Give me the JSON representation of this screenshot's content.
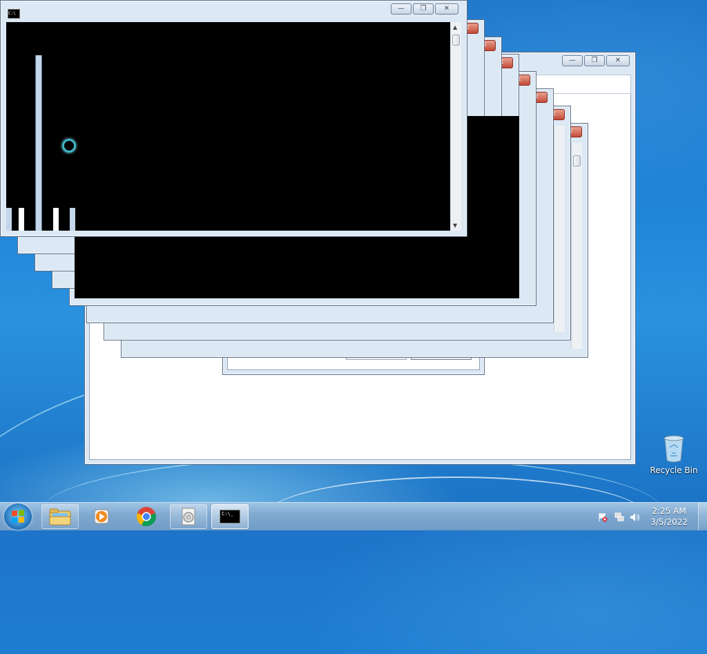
{
  "desktop": {
    "icons": [
      {
        "label": "Recycle Bin",
        "icon": "recycle-bin-icon"
      }
    ]
  },
  "windows": {
    "main": {
      "title_icon_text": "C:\\",
      "icon": "command-prompt-icon",
      "buttons": [
        "minimize",
        "maximize",
        "close"
      ]
    },
    "caption_glyphs": {
      "minimize": "—",
      "maximize": "❐",
      "close": "✕"
    }
  },
  "taskbar": {
    "start_icon": "windows-start-orb",
    "items": [
      {
        "name": "windows-explorer",
        "icon": "folder-icon"
      },
      {
        "name": "media-player",
        "icon": "media-player-icon"
      },
      {
        "name": "chrome",
        "icon": "chrome-icon"
      },
      {
        "name": "program",
        "icon": "disc-program-icon"
      },
      {
        "name": "command-prompt",
        "icon": "cmd-icon",
        "label": "C:\\_",
        "active": true
      }
    ],
    "tray": {
      "icons": [
        "action-center-flag-icon",
        "network-icon",
        "volume-icon"
      ],
      "time": "2:25 AM",
      "date": "3/5/2022"
    }
  },
  "colors": {
    "close_red": "#c44a37",
    "console_bg": "#000000",
    "spinner": "#3fb6c9"
  }
}
